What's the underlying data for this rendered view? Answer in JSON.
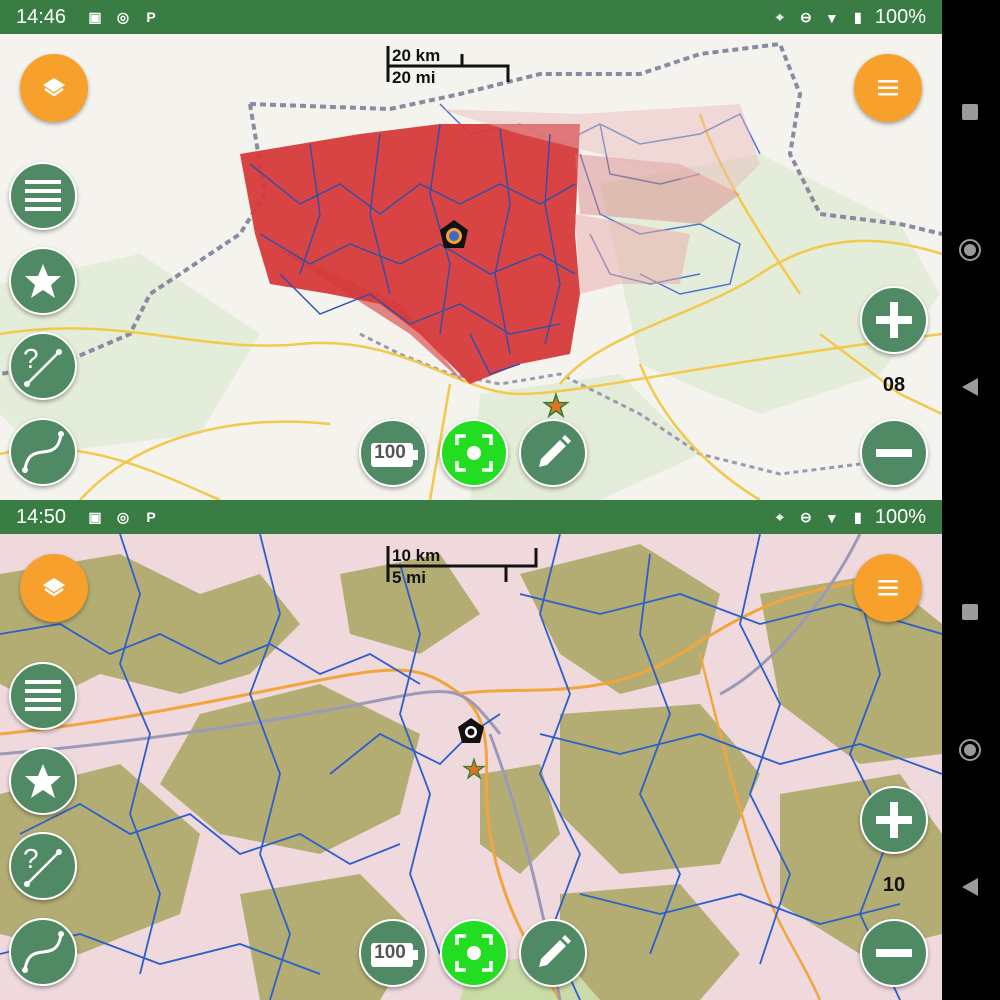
{
  "screens": [
    {
      "status": {
        "time": "14:46",
        "battery": "100%"
      },
      "scale": {
        "metric": "20 km",
        "imperial": "20 mi"
      },
      "zoom": "08"
    },
    {
      "status": {
        "time": "14:50",
        "battery": "100%"
      },
      "scale": {
        "metric": "10 km",
        "imperial": "5 mi"
      },
      "zoom": "10"
    }
  ],
  "buttons": {
    "battery_level": "100"
  },
  "icons": {
    "layers": "layers-icon",
    "menu": "hamburger-menu-icon",
    "list": "list-icon",
    "favorite": "star-icon",
    "route_question": "route-query-icon",
    "track": "track-curve-icon",
    "battery": "battery-icon",
    "gps": "gps-focus-icon",
    "edit": "pencil-icon",
    "zoom_in": "plus-icon",
    "zoom_out": "minus-icon"
  },
  "colors": {
    "status_bar": "#3a7d44",
    "fab_orange": "#f7a02c",
    "fab_green": "#4f8a64",
    "gps_active": "#22dd22",
    "coverage_area": "#d63a3a"
  }
}
